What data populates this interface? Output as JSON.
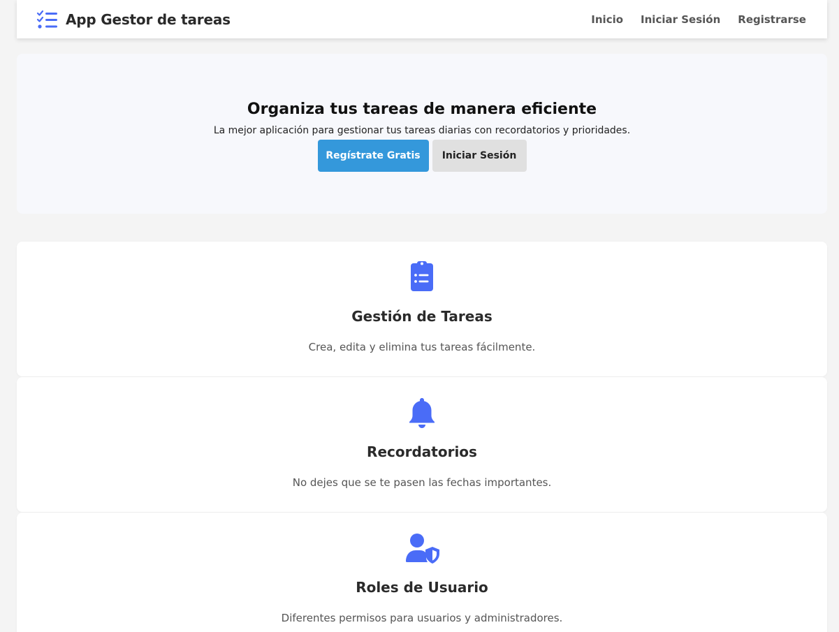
{
  "navbar": {
    "brand_icon": "task-list-icon",
    "brand_title": "App Gestor de tareas",
    "links": [
      {
        "label": "Inicio"
      },
      {
        "label": "Iniciar Sesión"
      },
      {
        "label": "Registrarse"
      }
    ]
  },
  "hero": {
    "title": "Organiza tus tareas de manera eficiente",
    "subtitle": "La mejor aplicación para gestionar tus tareas diarias con recordatorios y prioridades.",
    "primary_button": "Regístrate Gratis",
    "secondary_button": "Iniciar Sesión"
  },
  "features": [
    {
      "icon": "clipboard-list-icon",
      "title": "Gestión de Tareas",
      "description": "Crea, edita y elimina tus tareas fácilmente."
    },
    {
      "icon": "bell-icon",
      "title": "Recordatorios",
      "description": "No dejes que se te pasen las fechas importantes."
    },
    {
      "icon": "user-shield-icon",
      "title": "Roles de Usuario",
      "description": "Diferentes permisos para usuarios y administradores."
    }
  ],
  "colors": {
    "accent_icon": "#4a6cf7",
    "primary_button": "#3498db",
    "secondary_button": "#e0e0e0",
    "page_background": "#f4f4f4",
    "hero_background": "#f7f8fc"
  }
}
